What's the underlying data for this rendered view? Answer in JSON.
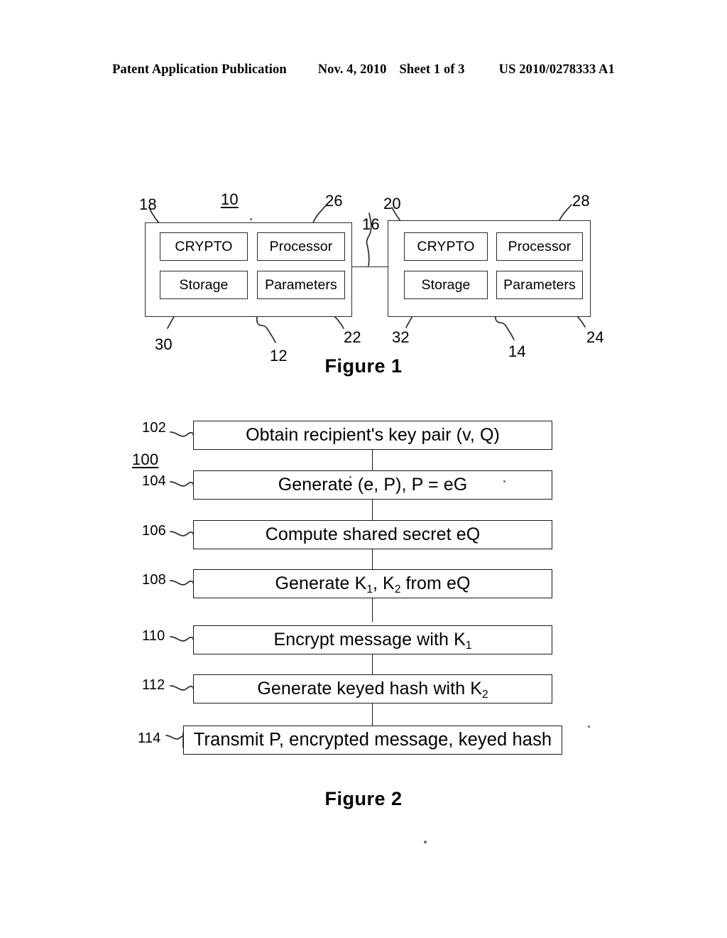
{
  "header": {
    "publication": "Patent Application Publication",
    "date": "Nov. 4, 2010",
    "sheet": "Sheet 1 of 3",
    "patent_number": "US 2010/0278333 A1"
  },
  "figure1": {
    "caption": "Figure 1",
    "system_ref": "10",
    "link_ref": "16",
    "left_device": {
      "ref": "12",
      "enclosure_ref": "18",
      "units": [
        {
          "label": "CRYPTO",
          "ref": "18"
        },
        {
          "label": "Processor",
          "ref": "26"
        },
        {
          "label": "Storage",
          "ref": "30"
        },
        {
          "label": "Parameters",
          "ref": "22"
        }
      ],
      "refs": {
        "crypto": "18",
        "processor": "26",
        "storage": "30",
        "parameters": "22",
        "device": "12"
      }
    },
    "right_device": {
      "ref": "14",
      "units": [
        {
          "label": "CRYPTO",
          "ref": "20"
        },
        {
          "label": "Processor",
          "ref": "28"
        },
        {
          "label": "Storage",
          "ref": "32"
        },
        {
          "label": "Parameters",
          "ref": "24"
        }
      ],
      "refs": {
        "crypto": "20",
        "processor": "28",
        "storage": "32",
        "parameters": "24",
        "device": "14"
      }
    }
  },
  "figure2": {
    "caption": "Figure 2",
    "method_ref": "100",
    "steps": [
      {
        "ref": "102",
        "text": "Obtain recipient's key pair (v, Q)"
      },
      {
        "ref": "104",
        "text": "Generate (e, P), P = eG"
      },
      {
        "ref": "106",
        "text": "Compute shared secret eQ"
      },
      {
        "ref": "108",
        "text": "Generate K1, K2 from eQ"
      },
      {
        "ref": "110",
        "text": "Encrypt message with K1"
      },
      {
        "ref": "112",
        "text": "Generate keyed hash with K2"
      },
      {
        "ref": "114",
        "text": "Transmit P, encrypted message, keyed hash"
      }
    ]
  }
}
